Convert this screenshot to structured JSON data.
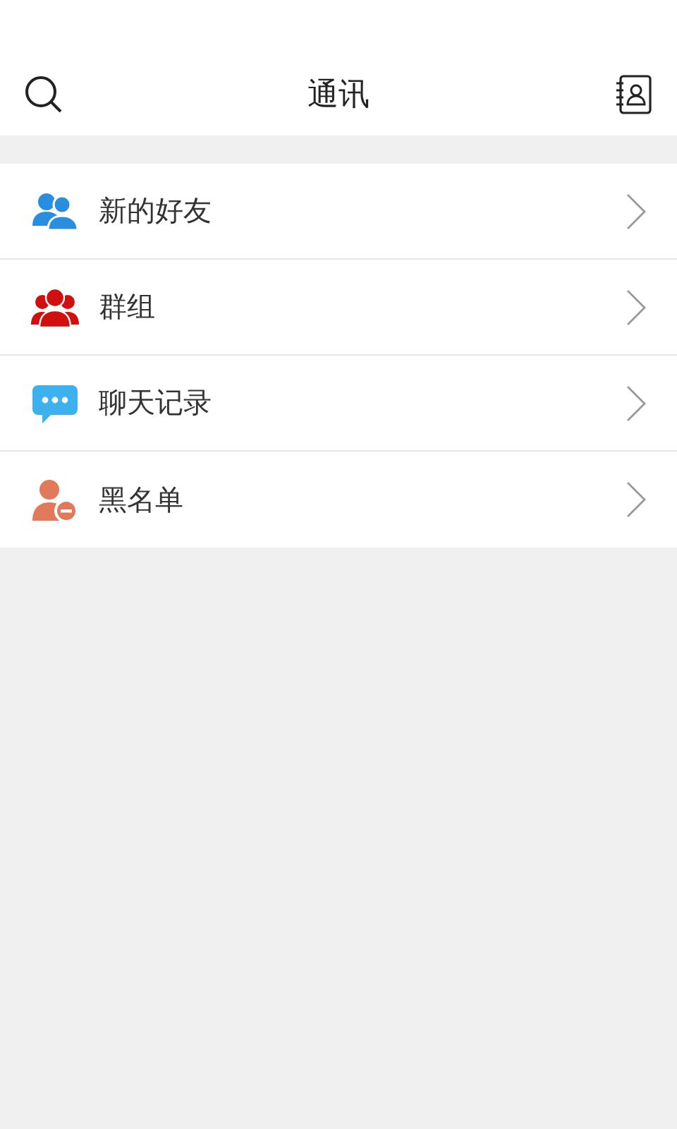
{
  "header": {
    "title": "通讯"
  },
  "items": [
    {
      "kind": "friends",
      "label": "新的好友"
    },
    {
      "kind": "group",
      "label": "群组"
    },
    {
      "kind": "chat",
      "label": "聊天记录"
    },
    {
      "kind": "blocked",
      "label": "黑名单"
    }
  ]
}
